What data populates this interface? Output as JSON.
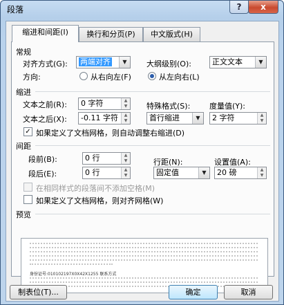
{
  "window": {
    "title": "段落",
    "help_icon": "?",
    "close_icon": "x"
  },
  "tabs": [
    {
      "label": "缩进和间距(I)"
    },
    {
      "label": "换行和分页(P)"
    },
    {
      "label": "中文版式(H)"
    }
  ],
  "general": {
    "section": "常规",
    "alignment_label": "对齐方式(G):",
    "alignment_value": "两端对齐",
    "outline_label": "大纲级别(O):",
    "outline_value": "正文文本",
    "direction_label": "方向:",
    "rtl_label": "从右向左(F)",
    "ltr_label": "从左向右(L)",
    "direction_selected": "ltr"
  },
  "indent": {
    "section": "缩进",
    "before_label": "文本之前(R):",
    "before_value": "0 字符",
    "after_label": "文本之后(X):",
    "after_value": "-0.11 字符",
    "special_label": "特殊格式(S):",
    "special_value": "首行缩进",
    "by_label": "度量值(Y):",
    "by_value": "2 字符",
    "grid_check_label": "如果定义了文档网格，则自动调整右缩进(D)",
    "grid_checked": true
  },
  "spacing": {
    "section": "间距",
    "before_label": "段前(B):",
    "before_value": "0 行",
    "after_label": "段后(E):",
    "after_value": "0 行",
    "line_label": "行距(N):",
    "line_value": "固定值",
    "at_label": "设置值(A):",
    "at_value": "20 磅",
    "nospace_label": "在相同样式的段落间不添加空格(M)",
    "nospace_checked": false,
    "snap_label": "如果定义了文档网格，则对齐网格(W)",
    "snap_checked": false
  },
  "preview": {
    "section": "预览",
    "sample_text": "身份证号:010102197X0X42X1255    联系方式"
  },
  "buttons": {
    "tabs": "制表位(T)...",
    "ok": "确定",
    "cancel": "取消"
  },
  "colors": {
    "selection": "#3399ff",
    "preview_line": "#c4c4c4",
    "ok_border": "#3c7fb1"
  }
}
